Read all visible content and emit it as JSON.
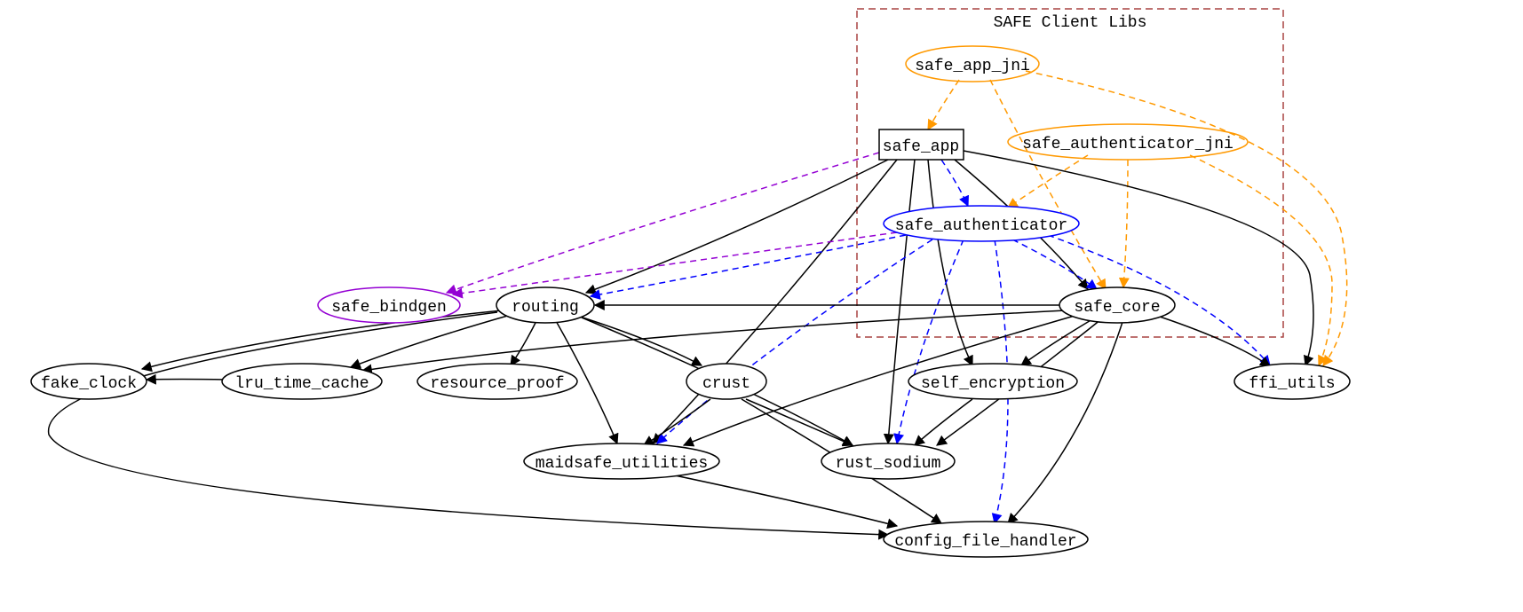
{
  "diagram": {
    "cluster": {
      "label": "SAFE Client Libs"
    },
    "nodes": {
      "safe_app_jni": "safe_app_jni",
      "safe_app": "safe_app",
      "safe_authenticator_jni": "safe_authenticator_jni",
      "safe_authenticator": "safe_authenticator",
      "safe_core": "safe_core",
      "safe_bindgen": "safe_bindgen",
      "routing": "routing",
      "fake_clock": "fake_clock",
      "lru_time_cache": "lru_time_cache",
      "resource_proof": "resource_proof",
      "crust": "crust",
      "self_encryption": "self_encryption",
      "ffi_utils": "ffi_utils",
      "maidsafe_utilities": "maidsafe_utilities",
      "rust_sodium": "rust_sodium",
      "config_file_handler": "config_file_handler"
    }
  },
  "chart_data": {
    "type": "graph",
    "cluster": {
      "id": "cluster_safe_client_libs",
      "label": "SAFE Client Libs",
      "style": "dashed",
      "color": "#A94442",
      "members": [
        "safe_app_jni",
        "safe_app",
        "safe_authenticator_jni",
        "safe_authenticator",
        "safe_core"
      ]
    },
    "nodes": [
      {
        "id": "safe_app_jni",
        "shape": "ellipse",
        "color": "orange"
      },
      {
        "id": "safe_app",
        "shape": "rect",
        "color": "black"
      },
      {
        "id": "safe_authenticator_jni",
        "shape": "ellipse",
        "color": "orange"
      },
      {
        "id": "safe_authenticator",
        "shape": "ellipse",
        "color": "blue"
      },
      {
        "id": "safe_core",
        "shape": "ellipse",
        "color": "black"
      },
      {
        "id": "safe_bindgen",
        "shape": "ellipse",
        "color": "purple"
      },
      {
        "id": "routing",
        "shape": "ellipse",
        "color": "black"
      },
      {
        "id": "fake_clock",
        "shape": "ellipse",
        "color": "black"
      },
      {
        "id": "lru_time_cache",
        "shape": "ellipse",
        "color": "black"
      },
      {
        "id": "resource_proof",
        "shape": "ellipse",
        "color": "black"
      },
      {
        "id": "crust",
        "shape": "ellipse",
        "color": "black"
      },
      {
        "id": "self_encryption",
        "shape": "ellipse",
        "color": "black"
      },
      {
        "id": "ffi_utils",
        "shape": "ellipse",
        "color": "black"
      },
      {
        "id": "maidsafe_utilities",
        "shape": "ellipse",
        "color": "black"
      },
      {
        "id": "rust_sodium",
        "shape": "ellipse",
        "color": "black"
      },
      {
        "id": "config_file_handler",
        "shape": "ellipse",
        "color": "black"
      }
    ],
    "edges": [
      {
        "from": "safe_app_jni",
        "to": "safe_app",
        "style": "dashed",
        "color": "orange"
      },
      {
        "from": "safe_app_jni",
        "to": "safe_core",
        "style": "dashed",
        "color": "orange"
      },
      {
        "from": "safe_app_jni",
        "to": "ffi_utils",
        "style": "dashed",
        "color": "orange"
      },
      {
        "from": "safe_authenticator_jni",
        "to": "safe_authenticator",
        "style": "dashed",
        "color": "orange"
      },
      {
        "from": "safe_authenticator_jni",
        "to": "safe_core",
        "style": "dashed",
        "color": "orange"
      },
      {
        "from": "safe_authenticator_jni",
        "to": "ffi_utils",
        "style": "dashed",
        "color": "orange"
      },
      {
        "from": "safe_app",
        "to": "safe_authenticator",
        "style": "dashed",
        "color": "blue"
      },
      {
        "from": "safe_app",
        "to": "safe_core",
        "style": "solid",
        "color": "black"
      },
      {
        "from": "safe_app",
        "to": "safe_bindgen",
        "style": "dashed",
        "color": "purple"
      },
      {
        "from": "safe_app",
        "to": "routing",
        "style": "solid",
        "color": "black"
      },
      {
        "from": "safe_app",
        "to": "self_encryption",
        "style": "solid",
        "color": "black"
      },
      {
        "from": "safe_app",
        "to": "ffi_utils",
        "style": "solid",
        "color": "black"
      },
      {
        "from": "safe_app",
        "to": "maidsafe_utilities",
        "style": "solid",
        "color": "black"
      },
      {
        "from": "safe_app",
        "to": "rust_sodium",
        "style": "solid",
        "color": "black"
      },
      {
        "from": "safe_authenticator",
        "to": "safe_bindgen",
        "style": "dashed",
        "color": "purple"
      },
      {
        "from": "safe_authenticator",
        "to": "safe_core",
        "style": "dashed",
        "color": "blue"
      },
      {
        "from": "safe_authenticator",
        "to": "routing",
        "style": "dashed",
        "color": "blue"
      },
      {
        "from": "safe_authenticator",
        "to": "ffi_utils",
        "style": "dashed",
        "color": "blue"
      },
      {
        "from": "safe_authenticator",
        "to": "maidsafe_utilities",
        "style": "dashed",
        "color": "blue"
      },
      {
        "from": "safe_authenticator",
        "to": "rust_sodium",
        "style": "dashed",
        "color": "blue"
      },
      {
        "from": "safe_authenticator",
        "to": "config_file_handler",
        "style": "dashed",
        "color": "blue"
      },
      {
        "from": "safe_core",
        "to": "routing",
        "style": "solid",
        "color": "black"
      },
      {
        "from": "safe_core",
        "to": "self_encryption",
        "style": "solid",
        "color": "black"
      },
      {
        "from": "safe_core",
        "to": "ffi_utils",
        "style": "solid",
        "color": "black"
      },
      {
        "from": "safe_core",
        "to": "maidsafe_utilities",
        "style": "solid",
        "color": "black"
      },
      {
        "from": "safe_core",
        "to": "rust_sodium",
        "style": "solid",
        "color": "black"
      },
      {
        "from": "safe_core",
        "to": "config_file_handler",
        "style": "solid",
        "color": "black"
      },
      {
        "from": "safe_core",
        "to": "lru_time_cache",
        "style": "solid",
        "color": "black"
      },
      {
        "from": "routing",
        "to": "fake_clock",
        "style": "solid",
        "color": "black"
      },
      {
        "from": "routing",
        "to": "lru_time_cache",
        "style": "solid",
        "color": "black"
      },
      {
        "from": "routing",
        "to": "resource_proof",
        "style": "solid",
        "color": "black"
      },
      {
        "from": "routing",
        "to": "crust",
        "style": "solid",
        "color": "black"
      },
      {
        "from": "routing",
        "to": "maidsafe_utilities",
        "style": "solid",
        "color": "black"
      },
      {
        "from": "routing",
        "to": "rust_sodium",
        "style": "solid",
        "color": "black"
      },
      {
        "from": "routing",
        "to": "config_file_handler",
        "style": "solid",
        "color": "black"
      },
      {
        "from": "crust",
        "to": "maidsafe_utilities",
        "style": "solid",
        "color": "black"
      },
      {
        "from": "crust",
        "to": "rust_sodium",
        "style": "solid",
        "color": "black"
      },
      {
        "from": "crust",
        "to": "config_file_handler",
        "style": "solid",
        "color": "black"
      },
      {
        "from": "self_encryption",
        "to": "rust_sodium",
        "style": "solid",
        "color": "black"
      },
      {
        "from": "lru_time_cache",
        "to": "fake_clock",
        "style": "solid",
        "color": "black"
      },
      {
        "from": "maidsafe_utilities",
        "to": "config_file_handler",
        "style": "solid",
        "color": "black"
      }
    ]
  }
}
